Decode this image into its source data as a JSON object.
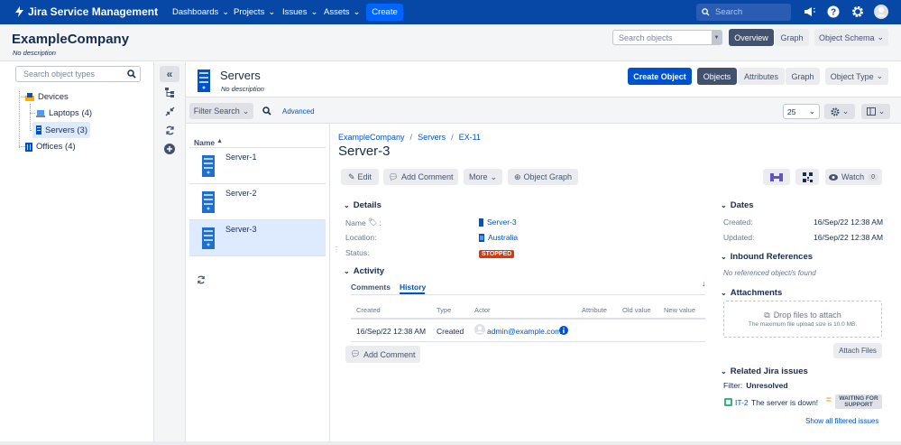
{
  "nav": {
    "brand": "Jira Service Management",
    "menus": [
      "Dashboards",
      "Projects",
      "Issues",
      "Assets"
    ],
    "create": "Create",
    "search_placeholder": "Search"
  },
  "header": {
    "title": "ExampleCompany",
    "subtitle": "No description",
    "search_placeholder": "Search objects",
    "tabs": [
      "Overview",
      "Graph"
    ],
    "schema_btn": "Object Schema"
  },
  "left": {
    "search_placeholder": "Search object types",
    "tree": {
      "devices": "Devices",
      "laptops": "Laptops (4)",
      "servers": "Servers (3)",
      "offices": "Offices (4)"
    }
  },
  "type_header": {
    "title": "Servers",
    "subtitle": "No description",
    "create_btn": "Create Object",
    "tabs": [
      "Objects",
      "Attributes",
      "Graph"
    ],
    "object_type_btn": "Object Type"
  },
  "filter": {
    "filter_btn": "Filter Search",
    "advanced": "Advanced",
    "page_size": "25"
  },
  "list": {
    "header": "Name",
    "items": [
      "Server-1",
      "Server-2",
      "Server-3"
    ]
  },
  "detail": {
    "breadcrumb": [
      "ExampleCompany",
      "Servers",
      "EX-11"
    ],
    "title": "Server-3",
    "actions": {
      "edit": "Edit",
      "add_comment": "Add Comment",
      "more": "More",
      "object_graph": "Object Graph",
      "watch": "Watch",
      "watch_count": "0"
    },
    "details": {
      "title": "Details",
      "name_label": "Name",
      "name_value": "Server-3",
      "location_label": "Location:",
      "location_value": "Australia",
      "status_label": "Status:",
      "status_value": "STOPPED"
    },
    "activity": {
      "title": "Activity",
      "tabs": [
        "Comments",
        "History"
      ],
      "columns": [
        "Created",
        "Type",
        "Actor",
        "Attribute",
        "Old value",
        "New value"
      ],
      "row": {
        "created": "16/Sep/22 12:38 AM",
        "type": "Created",
        "actor": "admin@example.com"
      },
      "add_comment": "Add Comment"
    },
    "dates": {
      "title": "Dates",
      "created_label": "Created:",
      "created_value": "16/Sep/22 12:38 AM",
      "updated_label": "Updated:",
      "updated_value": "16/Sep/22 12:38 AM"
    },
    "inbound": {
      "title": "Inbound References",
      "empty": "No referenced object/s found"
    },
    "attachments": {
      "title": "Attachments",
      "drop": "Drop files to attach",
      "limit": "The maximum file upload size is 10.0 MB.",
      "attach_btn": "Attach Files"
    },
    "jira": {
      "title": "Related Jira issues",
      "filter_label": "Filter:",
      "filter_value": "Unresolved",
      "issue_key": "IT-2",
      "issue_summary": "The server is down!",
      "issue_status_1": "WAITING FOR",
      "issue_status_2": "SUPPORT",
      "show_all": "Show all filtered issues"
    }
  }
}
